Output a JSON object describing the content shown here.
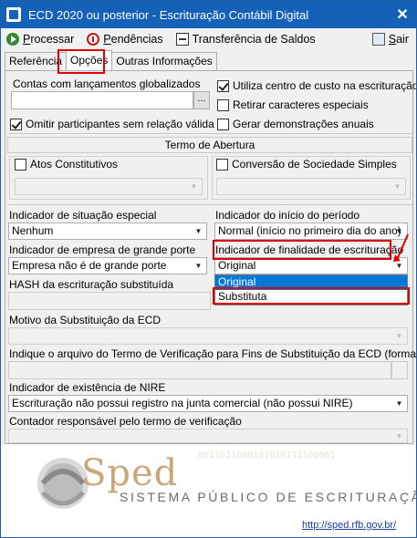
{
  "window": {
    "title": "ECD 2020 ou posterior - Escrituração Contábil Digital",
    "close_glyph": "✕"
  },
  "toolbar": {
    "processar_key": "P",
    "processar_rest": "rocessar",
    "pendencias_pre": "",
    "pendencias_key": "P",
    "pendencias_rest": "endências",
    "transferencia_label": "Transferência de Saldos",
    "sair_key": "S",
    "sair_rest": "air"
  },
  "tabs": [
    "Referência",
    "Opções",
    "Outras Informações"
  ],
  "options": {
    "contas_label": "Contas com lançamentos globalizados",
    "contas_value": "",
    "dots_button": "...",
    "utiliza_centro": {
      "label": "Utiliza centro de custo na escrituração",
      "checked": true
    },
    "retirar_caracteres": {
      "label": "Retirar caracteres especiais",
      "checked": false
    },
    "omitir_participantes": {
      "label": "Omitir participantes sem relação válida",
      "checked": true
    },
    "gerar_demonstracoes": {
      "label": "Gerar demonstrações anuais",
      "checked": false
    }
  },
  "termo_abertura": {
    "title": "Termo de Abertura",
    "atos_constitutivos": "Atos Constitutivos",
    "conversao": "Conversão de Sociedade Simples"
  },
  "fields": {
    "situacao_especial_label": "Indicador de situação especial",
    "situacao_especial_value": "Nenhum",
    "inicio_periodo_label": "Indicador do início do período",
    "inicio_periodo_value": "Normal (início no primeiro dia do ano)",
    "grande_porte_label": "Indicador de empresa de grande porte",
    "grande_porte_value": "Empresa não é de grande porte",
    "finalidade_label": "Indicador de finalidade de escrituração",
    "finalidade_value": "Original",
    "finalidade_options": [
      "Original",
      "Substituta"
    ],
    "hash_label": "HASH da escrituração substituída",
    "motivo_label": "Motivo da Substituição da ECD",
    "termo_verificacao_label": "Indique o arquivo do Termo de Verificação para Fins de Substituição da ECD (formato rtf)",
    "nire_label": "Indicador de existência de NIRE",
    "nire_value": "Escrituração não possui registro na junta comercial (não possui NIRE)",
    "contador_label": "Contador responsável pelo termo de verificação"
  },
  "banner": {
    "brand": "Sped",
    "subtitle": "SISTEMA PÚBLICO DE ESCRITURAÇÃO DIGITAL",
    "url": "http://sped.rfb.gov.br/",
    "binary": "0011011000101010111100001"
  },
  "colors": {
    "titlebar": "#1461b7",
    "highlight": "#e00000",
    "selection": "#0078d7",
    "brand": "#c9a77a"
  }
}
